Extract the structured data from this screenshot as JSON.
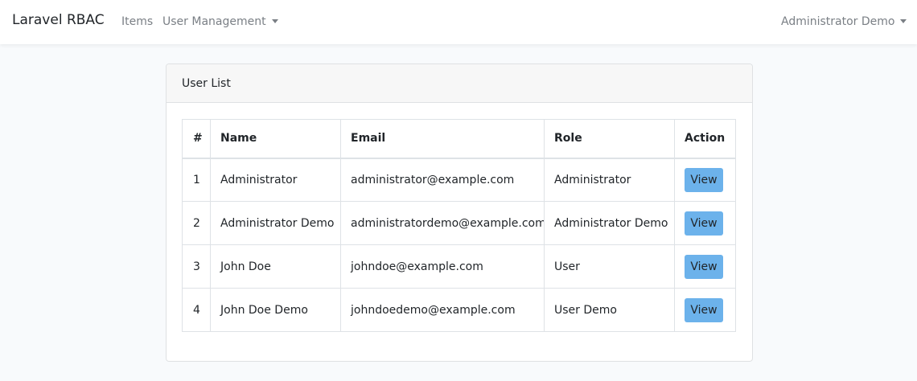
{
  "navbar": {
    "brand": "Laravel RBAC",
    "links": [
      {
        "label": "Items"
      },
      {
        "label": "User Management"
      }
    ],
    "account": "Administrator Demo"
  },
  "card": {
    "title": "User List"
  },
  "table": {
    "headers": [
      "#",
      "Name",
      "Email",
      "Role",
      "Action"
    ],
    "rows": [
      {
        "num": "1",
        "name": "Administrator",
        "email": "administrator@example.com",
        "role": "Administrator",
        "action": "View"
      },
      {
        "num": "2",
        "name": "Administrator Demo",
        "email": "administratordemo@example.com",
        "role": "Administrator Demo",
        "action": "View"
      },
      {
        "num": "3",
        "name": "John Doe",
        "email": "johndoe@example.com",
        "role": "User",
        "action": "View"
      },
      {
        "num": "4",
        "name": "John Doe Demo",
        "email": "johndoedemo@example.com",
        "role": "User Demo",
        "action": "View"
      }
    ]
  },
  "colors": {
    "accent_button": "#6cb2eb",
    "page_background": "#f8fafc"
  }
}
